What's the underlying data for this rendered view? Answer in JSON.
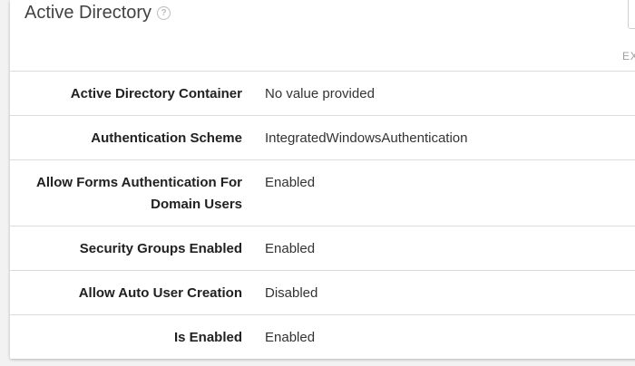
{
  "section": {
    "title": "Active Directory",
    "help_icon": "?",
    "export_label": "EX"
  },
  "rows": [
    {
      "label": "Active Directory Container",
      "value": "No value provided"
    },
    {
      "label": "Authentication Scheme",
      "value": "IntegratedWindowsAuthentication"
    },
    {
      "label": "Allow Forms Authentication For Domain Users",
      "value": "Enabled"
    },
    {
      "label": "Security Groups Enabled",
      "value": "Enabled"
    },
    {
      "label": "Allow Auto User Creation",
      "value": "Disabled"
    },
    {
      "label": "Is Enabled",
      "value": "Enabled"
    }
  ]
}
